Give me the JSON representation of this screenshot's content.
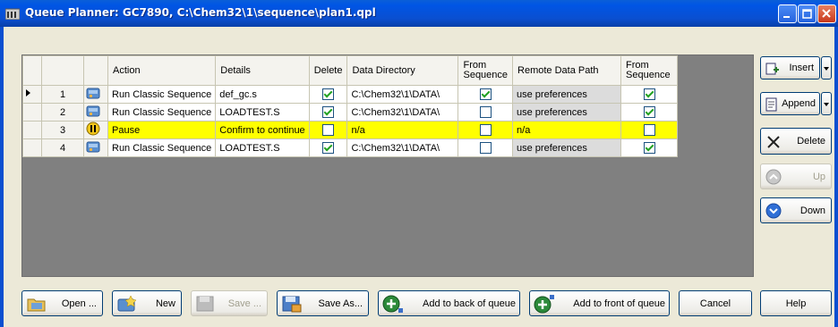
{
  "window": {
    "title": "Queue Planner: GC7890, C:\\Chem32\\1\\sequence\\plan1.qpl"
  },
  "columns": [
    "",
    "",
    "Action",
    "Details",
    "Delete",
    "Data Directory",
    "From Sequence",
    "Remote Data Path",
    "From Sequence"
  ],
  "rows": [
    {
      "num": "1",
      "current": true,
      "icon": "sequence-icon",
      "action": "Run Classic Sequence",
      "details": "def_gc.s",
      "delete": true,
      "data_directory": "C:\\Chem32\\1\\DATA\\",
      "from_sequence_dir": true,
      "remote_data_path": "use preferences",
      "from_sequence_remote": true
    },
    {
      "num": "2",
      "current": false,
      "icon": "sequence-icon",
      "action": "Run Classic Sequence",
      "details": "LOADTEST.S",
      "delete": true,
      "data_directory": "C:\\Chem32\\1\\DATA\\",
      "from_sequence_dir": false,
      "remote_data_path": "use preferences",
      "from_sequence_remote": true
    },
    {
      "num": "3",
      "current": false,
      "icon": "pause-icon",
      "action": "Pause",
      "details": "Confirm to continue",
      "delete": false,
      "data_directory": "n/a",
      "from_sequence_dir": false,
      "remote_data_path": "n/a",
      "from_sequence_remote": false
    },
    {
      "num": "4",
      "current": false,
      "icon": "sequence-icon",
      "action": "Run Classic Sequence",
      "details": "LOADTEST.S",
      "delete": true,
      "data_directory": "C:\\Chem32\\1\\DATA\\",
      "from_sequence_dir": false,
      "remote_data_path": "use preferences",
      "from_sequence_remote": true
    }
  ],
  "side_buttons": {
    "insert": "Insert",
    "append": "Append",
    "delete": "Delete",
    "up": "Up",
    "down": "Down",
    "help": "Help"
  },
  "bottom_buttons": {
    "open": "Open ...",
    "new": "New",
    "save": "Save ...",
    "save_as": "Save As...",
    "add_back": "Add to back of queue",
    "add_front": "Add to front of queue",
    "cancel": "Cancel"
  },
  "colors": {
    "title_bar": "#0a4fd0",
    "pause_row": "#ffff00",
    "grid_background": "#808080"
  }
}
